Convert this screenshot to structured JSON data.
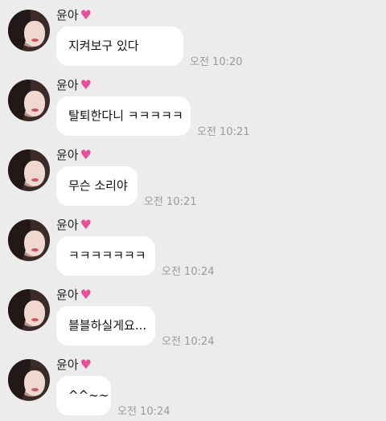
{
  "messages": [
    {
      "sender": "윤아",
      "icon": "heart-icon",
      "text": "지켜보구 있다",
      "time": "오전 10:20"
    },
    {
      "sender": "윤아",
      "icon": "heart-icon",
      "text": "탈퇴한다니 ㅋㅋㅋㅋㅋ",
      "time": "오전 10:21"
    },
    {
      "sender": "윤아",
      "icon": "heart-icon",
      "text": "무슨 소리야",
      "time": "오전 10:21"
    },
    {
      "sender": "윤아",
      "icon": "heart-icon",
      "text": "ㅋㅋㅋㅋㅋㅋㅋ",
      "time": "오전 10:24"
    },
    {
      "sender": "윤아",
      "icon": "heart-icon",
      "text": "블블하실게요...",
      "time": "오전 10:24"
    },
    {
      "sender": "윤아",
      "icon": "heart-icon",
      "text": "^^~~",
      "time": "오전 10:24"
    }
  ]
}
